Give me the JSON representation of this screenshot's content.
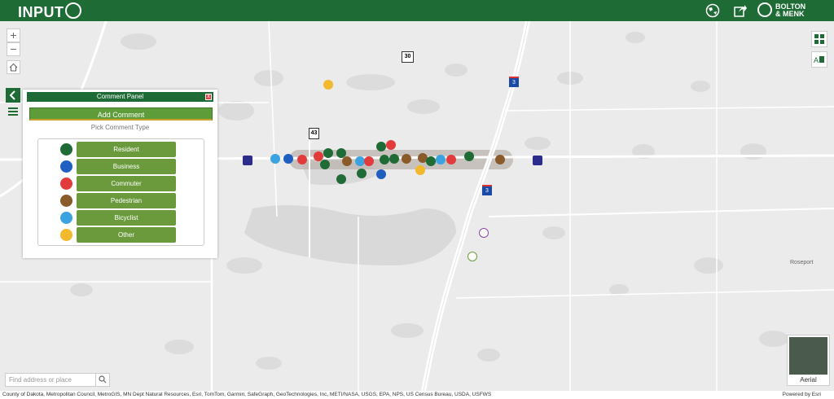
{
  "header": {
    "app_name": "INPUT",
    "brand_line1": "BOLTON",
    "brand_line2": "& MENK"
  },
  "comment_panel": {
    "title": "Comment Panel",
    "close_label": "x",
    "add_comment_label": "Add Comment",
    "pick_type_label": "Pick Comment Type",
    "types": [
      {
        "label": "Resident",
        "color": "#1f6b36",
        "icon": "house-icon"
      },
      {
        "label": "Business",
        "color": "#1f5fbf",
        "icon": "building-icon"
      },
      {
        "label": "Commuter",
        "color": "#e23b3b",
        "icon": "car-icon"
      },
      {
        "label": "Pedestrian",
        "color": "#8b5a2b",
        "icon": "walker-icon"
      },
      {
        "label": "Bicyclist",
        "color": "#3aa3e0",
        "icon": "bicycle-icon"
      },
      {
        "label": "Other",
        "color": "#f2b92c",
        "icon": "speech-bubble-icon"
      }
    ]
  },
  "map": {
    "zoom_in": "+",
    "zoom_out": "−",
    "search_placeholder": "Find address or place",
    "basemap_label": "Aerial",
    "place_labels": [
      "Roseport"
    ],
    "road_shields": [
      "30",
      "3",
      "43",
      "3"
    ],
    "attribution": "County of Dakota, Metropolitan Council, MetroGIS, MN Dept Natural Resources, Esri, TomTom, Garmin, SafeGraph, GeoTechnologies, Inc, METI/NASA, USGS, EPA, NPS, US Census Bureau, USDA, USFWS",
    "powered_by": "Powered by Esri"
  },
  "colors": {
    "header": "#1f6b36",
    "button_green": "#6a9a3c",
    "add_comment": "#5e9c3a"
  }
}
